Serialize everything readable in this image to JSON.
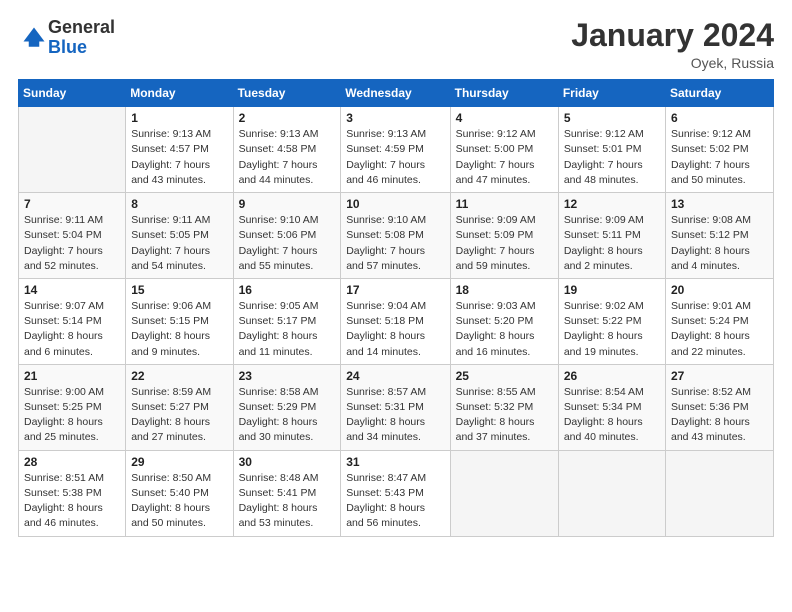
{
  "header": {
    "logo": {
      "general": "General",
      "blue": "Blue"
    },
    "title": "January 2024",
    "location": "Oyek, Russia"
  },
  "weekdays": [
    "Sunday",
    "Monday",
    "Tuesday",
    "Wednesday",
    "Thursday",
    "Friday",
    "Saturday"
  ],
  "weeks": [
    [
      {
        "day": "",
        "info": ""
      },
      {
        "day": "1",
        "info": "Sunrise: 9:13 AM\nSunset: 4:57 PM\nDaylight: 7 hours\nand 43 minutes."
      },
      {
        "day": "2",
        "info": "Sunrise: 9:13 AM\nSunset: 4:58 PM\nDaylight: 7 hours\nand 44 minutes."
      },
      {
        "day": "3",
        "info": "Sunrise: 9:13 AM\nSunset: 4:59 PM\nDaylight: 7 hours\nand 46 minutes."
      },
      {
        "day": "4",
        "info": "Sunrise: 9:12 AM\nSunset: 5:00 PM\nDaylight: 7 hours\nand 47 minutes."
      },
      {
        "day": "5",
        "info": "Sunrise: 9:12 AM\nSunset: 5:01 PM\nDaylight: 7 hours\nand 48 minutes."
      },
      {
        "day": "6",
        "info": "Sunrise: 9:12 AM\nSunset: 5:02 PM\nDaylight: 7 hours\nand 50 minutes."
      }
    ],
    [
      {
        "day": "7",
        "info": "Sunrise: 9:11 AM\nSunset: 5:04 PM\nDaylight: 7 hours\nand 52 minutes."
      },
      {
        "day": "8",
        "info": "Sunrise: 9:11 AM\nSunset: 5:05 PM\nDaylight: 7 hours\nand 54 minutes."
      },
      {
        "day": "9",
        "info": "Sunrise: 9:10 AM\nSunset: 5:06 PM\nDaylight: 7 hours\nand 55 minutes."
      },
      {
        "day": "10",
        "info": "Sunrise: 9:10 AM\nSunset: 5:08 PM\nDaylight: 7 hours\nand 57 minutes."
      },
      {
        "day": "11",
        "info": "Sunrise: 9:09 AM\nSunset: 5:09 PM\nDaylight: 7 hours\nand 59 minutes."
      },
      {
        "day": "12",
        "info": "Sunrise: 9:09 AM\nSunset: 5:11 PM\nDaylight: 8 hours\nand 2 minutes."
      },
      {
        "day": "13",
        "info": "Sunrise: 9:08 AM\nSunset: 5:12 PM\nDaylight: 8 hours\nand 4 minutes."
      }
    ],
    [
      {
        "day": "14",
        "info": "Sunrise: 9:07 AM\nSunset: 5:14 PM\nDaylight: 8 hours\nand 6 minutes."
      },
      {
        "day": "15",
        "info": "Sunrise: 9:06 AM\nSunset: 5:15 PM\nDaylight: 8 hours\nand 9 minutes."
      },
      {
        "day": "16",
        "info": "Sunrise: 9:05 AM\nSunset: 5:17 PM\nDaylight: 8 hours\nand 11 minutes."
      },
      {
        "day": "17",
        "info": "Sunrise: 9:04 AM\nSunset: 5:18 PM\nDaylight: 8 hours\nand 14 minutes."
      },
      {
        "day": "18",
        "info": "Sunrise: 9:03 AM\nSunset: 5:20 PM\nDaylight: 8 hours\nand 16 minutes."
      },
      {
        "day": "19",
        "info": "Sunrise: 9:02 AM\nSunset: 5:22 PM\nDaylight: 8 hours\nand 19 minutes."
      },
      {
        "day": "20",
        "info": "Sunrise: 9:01 AM\nSunset: 5:24 PM\nDaylight: 8 hours\nand 22 minutes."
      }
    ],
    [
      {
        "day": "21",
        "info": "Sunrise: 9:00 AM\nSunset: 5:25 PM\nDaylight: 8 hours\nand 25 minutes."
      },
      {
        "day": "22",
        "info": "Sunrise: 8:59 AM\nSunset: 5:27 PM\nDaylight: 8 hours\nand 27 minutes."
      },
      {
        "day": "23",
        "info": "Sunrise: 8:58 AM\nSunset: 5:29 PM\nDaylight: 8 hours\nand 30 minutes."
      },
      {
        "day": "24",
        "info": "Sunrise: 8:57 AM\nSunset: 5:31 PM\nDaylight: 8 hours\nand 34 minutes."
      },
      {
        "day": "25",
        "info": "Sunrise: 8:55 AM\nSunset: 5:32 PM\nDaylight: 8 hours\nand 37 minutes."
      },
      {
        "day": "26",
        "info": "Sunrise: 8:54 AM\nSunset: 5:34 PM\nDaylight: 8 hours\nand 40 minutes."
      },
      {
        "day": "27",
        "info": "Sunrise: 8:52 AM\nSunset: 5:36 PM\nDaylight: 8 hours\nand 43 minutes."
      }
    ],
    [
      {
        "day": "28",
        "info": "Sunrise: 8:51 AM\nSunset: 5:38 PM\nDaylight: 8 hours\nand 46 minutes."
      },
      {
        "day": "29",
        "info": "Sunrise: 8:50 AM\nSunset: 5:40 PM\nDaylight: 8 hours\nand 50 minutes."
      },
      {
        "day": "30",
        "info": "Sunrise: 8:48 AM\nSunset: 5:41 PM\nDaylight: 8 hours\nand 53 minutes."
      },
      {
        "day": "31",
        "info": "Sunrise: 8:47 AM\nSunset: 5:43 PM\nDaylight: 8 hours\nand 56 minutes."
      },
      {
        "day": "",
        "info": ""
      },
      {
        "day": "",
        "info": ""
      },
      {
        "day": "",
        "info": ""
      }
    ]
  ]
}
